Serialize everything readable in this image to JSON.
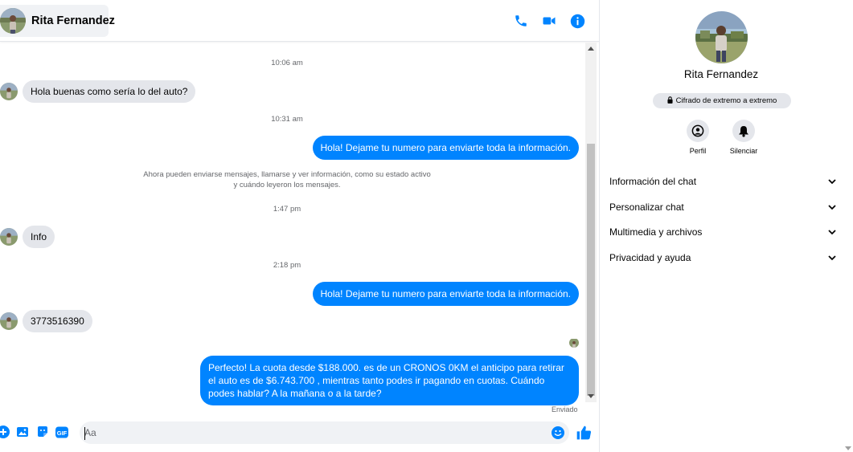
{
  "header": {
    "contact_name": "Rita Fernandez",
    "icons": [
      "phone-icon",
      "video-camera-icon",
      "info-icon"
    ]
  },
  "messages": {
    "timestamps": [
      "10:06 am",
      "10:31 am",
      "1:47 pm",
      "2:18 pm"
    ],
    "system_notice": "Ahora pueden enviarse mensajes, llamarse y ver información, como su estado activo y cuándo leyeron los mensajes.",
    "items": [
      {
        "direction": "incoming",
        "text": "Hola buenas como sería lo del auto?"
      },
      {
        "direction": "outgoing",
        "text": "Hola! Dejame tu numero  para enviarte toda la información."
      },
      {
        "direction": "incoming",
        "text": "Info"
      },
      {
        "direction": "outgoing",
        "text": "Hola! Dejame tu numero  para enviarte toda la información."
      },
      {
        "direction": "incoming",
        "text": "3773516390"
      },
      {
        "direction": "outgoing",
        "text": "Perfecto! La cuota desde $188.000. es de un CRONOS 0KM el anticipo para retirar el auto es de $6.743.700 , mientras tanto podes ir pagando en cuotas. Cuándo podes hablar? A la mañana o a la tarde?"
      }
    ],
    "status": "Enviado"
  },
  "composer": {
    "placeholder": "Aa",
    "value": "",
    "icons": [
      "plus-circle-icon",
      "photo-icon",
      "sticker-icon",
      "gif-icon",
      "emoji-icon",
      "thumbs-up-icon"
    ],
    "gif_label": "GIF"
  },
  "right_panel": {
    "name": "Rita Fernandez",
    "encryption_badge": "Cifrado de extremo a extremo",
    "actions": [
      {
        "label": "Perfil",
        "icon": "profile-icon"
      },
      {
        "label": "Silenciar",
        "icon": "bell-icon"
      }
    ],
    "sections": [
      {
        "label": "Información del chat"
      },
      {
        "label": "Personalizar chat"
      },
      {
        "label": "Multimedia y archivos"
      },
      {
        "label": "Privacidad y ayuda"
      }
    ]
  },
  "colors": {
    "accent": "#0084ff",
    "incoming_bubble": "#e4e6eb",
    "panel_bg": "#f0f2f5",
    "secondary_text": "#65676b"
  }
}
